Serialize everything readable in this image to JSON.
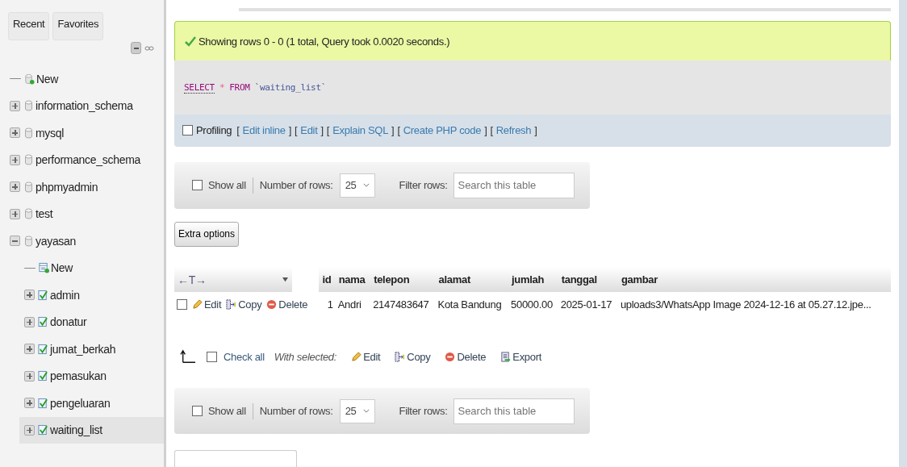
{
  "sidebar": {
    "tabs": [
      {
        "label": "Recent"
      },
      {
        "label": "Favorites"
      }
    ],
    "tree": [
      {
        "label": "New",
        "kind": "new",
        "selected": false
      },
      {
        "label": "information_schema",
        "kind": "database",
        "expanded": false,
        "selected": false
      },
      {
        "label": "mysql",
        "kind": "database",
        "expanded": false,
        "selected": false
      },
      {
        "label": "performance_schema",
        "kind": "database",
        "expanded": false,
        "selected": false
      },
      {
        "label": "phpmyadmin",
        "kind": "database",
        "expanded": false,
        "selected": false
      },
      {
        "label": "test",
        "kind": "database",
        "expanded": false,
        "selected": false
      },
      {
        "label": "yayasan",
        "kind": "database",
        "expanded": true,
        "selected": false,
        "children": [
          {
            "label": "New",
            "kind": "new-table",
            "selected": false
          },
          {
            "label": "admin",
            "kind": "table",
            "expanded": false,
            "selected": false
          },
          {
            "label": "donatur",
            "kind": "table",
            "expanded": false,
            "selected": false
          },
          {
            "label": "jumat_berkah",
            "kind": "table",
            "expanded": false,
            "selected": false
          },
          {
            "label": "pemasukan",
            "kind": "table",
            "expanded": false,
            "selected": false
          },
          {
            "label": "pengeluaran",
            "kind": "table",
            "expanded": false,
            "selected": false
          },
          {
            "label": "waiting_list",
            "kind": "table",
            "expanded": false,
            "selected": true
          }
        ]
      }
    ]
  },
  "success_message": "Showing rows 0 - 0 (1 total, Query took 0.0020 seconds.)",
  "sql_query": [
    {
      "text": "SELECT",
      "kind": "keyword-link"
    },
    {
      "text": "*",
      "kind": "operator"
    },
    {
      "text": "FROM",
      "kind": "keyword"
    },
    {
      "text": "`waiting_list`",
      "kind": "identifier"
    }
  ],
  "profiling": {
    "label": "Profiling",
    "checked": false,
    "links": [
      {
        "open": "[",
        "text": "Edit inline",
        "close": "]"
      },
      {
        "open": "[",
        "text": "Edit",
        "close": "]"
      },
      {
        "open": "[",
        "text": "Explain SQL",
        "close": "]"
      },
      {
        "open": "[",
        "text": "Create PHP code",
        "close": "]"
      },
      {
        "open": "[",
        "text": "Refresh",
        "close": "]"
      }
    ]
  },
  "navigation_top": {
    "show_all": "Show all",
    "show_all_checked": false,
    "rows_label": "Number of rows:",
    "rows_value": "25",
    "filter_label": "Filter rows:",
    "filter_placeholder": "Search this table"
  },
  "extra_options": "Extra options",
  "table": {
    "toggle": "←T→",
    "columns": [
      "id",
      "nama",
      "telepon",
      "alamat",
      "jumlah",
      "tanggal",
      "gambar"
    ],
    "rows": [
      {
        "checked": false,
        "actions": [
          "Edit",
          "Copy",
          "Delete"
        ],
        "cells": [
          "1",
          "Andri",
          "2147483647",
          "Kota Bandung",
          "50000.00",
          "2025-01-17",
          "uploads3/WhatsApp Image 2024-12-16 at 05.27.12.jpe..."
        ]
      }
    ]
  },
  "bulk_actions": {
    "check_all": "Check all",
    "checked": false,
    "with_selected": "With selected:",
    "buttons": [
      {
        "label": "Edit",
        "kind": "edit"
      },
      {
        "label": "Copy",
        "kind": "copy"
      },
      {
        "label": "Delete",
        "kind": "delete"
      },
      {
        "label": "Export",
        "kind": "export"
      }
    ]
  },
  "navigation_bottom": {
    "show_all": "Show all",
    "show_all_checked": false,
    "rows_label": "Number of rows:",
    "rows_value": "25",
    "filter_label": "Filter rows:",
    "filter_placeholder": "Search this table"
  }
}
